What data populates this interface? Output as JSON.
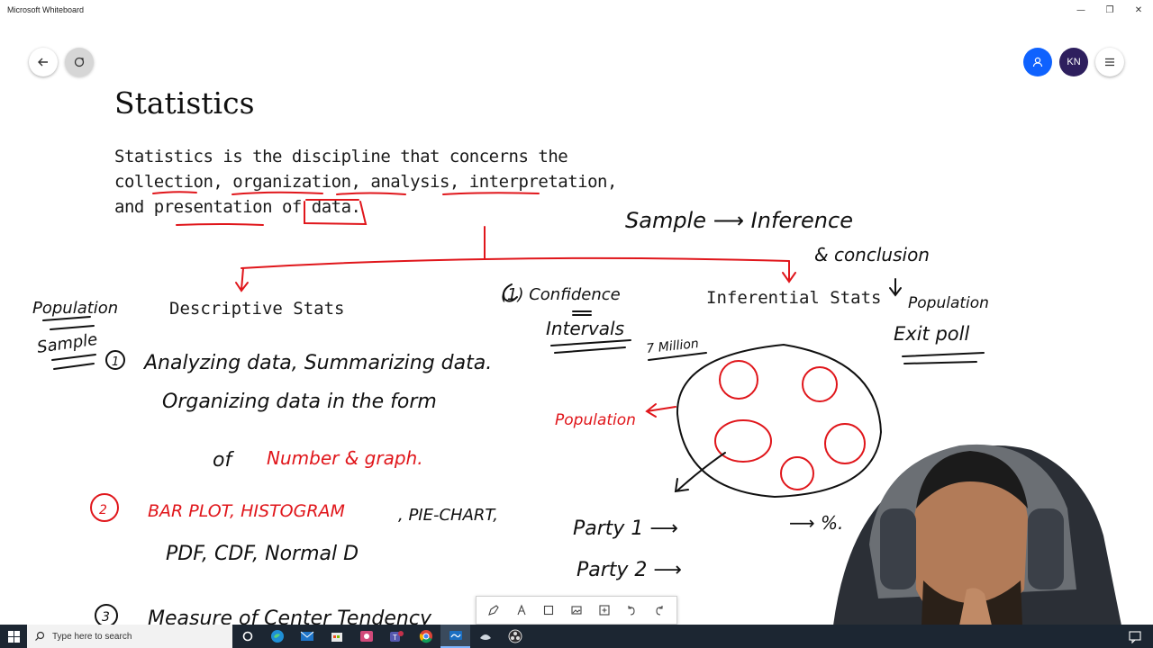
{
  "window": {
    "title": "Microsoft Whiteboard",
    "minimize_glyph": "—",
    "restore_glyph": "❐",
    "close_glyph": "✕"
  },
  "canvas_controls": {
    "back_icon": "arrow-left-icon",
    "share_icon": "share-refresh-icon",
    "invite_icon": "person-icon",
    "avatar_initials": "KN",
    "menu_icon": "hamburger-icon"
  },
  "content": {
    "heading": "Statistics",
    "definition_lines": [
      "Statistics is the discipline that concerns the",
      "collection, organization, analysis, interpretation,",
      "and presentation of data."
    ],
    "descriptive_title": "Descriptive Stats",
    "inferential_title": "Inferential Stats"
  },
  "handwriting": {
    "population_left": "Population",
    "sample_left": "Sample",
    "item1_num": "1",
    "item1_line1": "Analyzing data, Summarizing data.",
    "item1_line2": "Organizing data in the form",
    "item1_of": "of",
    "item1_red": "Number & graph.",
    "item2_num": "2",
    "item2_red": "BAR PLOT, HISTOGRAM",
    "item2_black": ", PIE-CHART,",
    "item2_line2": "PDF, CDF, Normal D",
    "item3_num": "3",
    "item3_text": "Measure of Center Tendency",
    "confidence_1": "(1) Confidence",
    "confidence_2": "Intervals",
    "sample_arrow": "Sample ⟶ Inference",
    "conclusion": "& conclusion",
    "population_right": "Population",
    "exit_poll": "Exit poll",
    "seven_million": "7 Million",
    "population_red": "Population",
    "party1": "Party 1 ⟶",
    "party2": "Party 2 ⟶",
    "party_result": "⟶ %."
  },
  "ink_toolbar": {
    "tools": [
      "pen-icon",
      "text-icon",
      "note-icon",
      "image-icon",
      "add-icon",
      "undo-icon",
      "redo-icon"
    ]
  },
  "taskbar": {
    "search_placeholder": "Type here to search",
    "apps": [
      "cortana-icon",
      "edge-icon",
      "mail-icon",
      "store-icon",
      "snip-icon",
      "teams-icon",
      "chrome-icon",
      "whiteboard-icon",
      "vpn-icon",
      "obs-icon"
    ],
    "teams_badge": "3"
  },
  "colors": {
    "ink_black": "#111111",
    "ink_red": "#e0161b",
    "accent": "#0f62fe",
    "avatar_bg": "#2e1f5e",
    "taskbar_bg": "#1c2632"
  }
}
